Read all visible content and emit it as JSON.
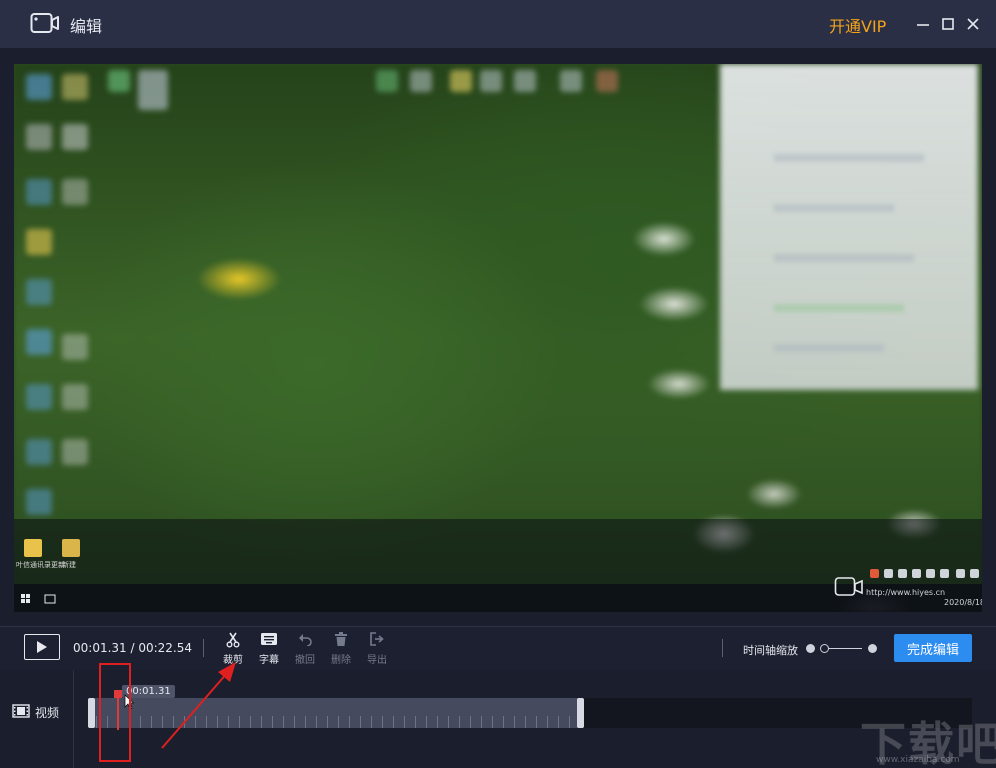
{
  "window": {
    "title": "编辑",
    "vip_label": "开通VIP"
  },
  "preview": {
    "desktop_files": [
      "叶信通讯录更新",
      "新建"
    ],
    "tray_url": "http://www.hiyes.cn",
    "tray_date": "2020/8/18"
  },
  "controls": {
    "current_time": "00:01.31",
    "total_time": "00:22.54",
    "tools": [
      {
        "label": "裁剪",
        "enabled": true
      },
      {
        "label": "字幕",
        "enabled": true
      },
      {
        "label": "撤回",
        "enabled": false
      },
      {
        "label": "删除",
        "enabled": false
      },
      {
        "label": "导出",
        "enabled": false
      }
    ],
    "zoom_label": "时间轴缩放",
    "finish_label": "完成编辑"
  },
  "timeline": {
    "track_label": "视频",
    "playhead_time": "00:01.31"
  },
  "watermark": {
    "text": "下载吧",
    "url": "www.xiazaiba.com"
  },
  "colors": {
    "titlebar": "#2a2f45",
    "background": "#1b1e2c",
    "vip": "#f3a31b",
    "accent": "#2d8cf0",
    "playhead": "#e03a3a",
    "annotation": "#e02020"
  }
}
